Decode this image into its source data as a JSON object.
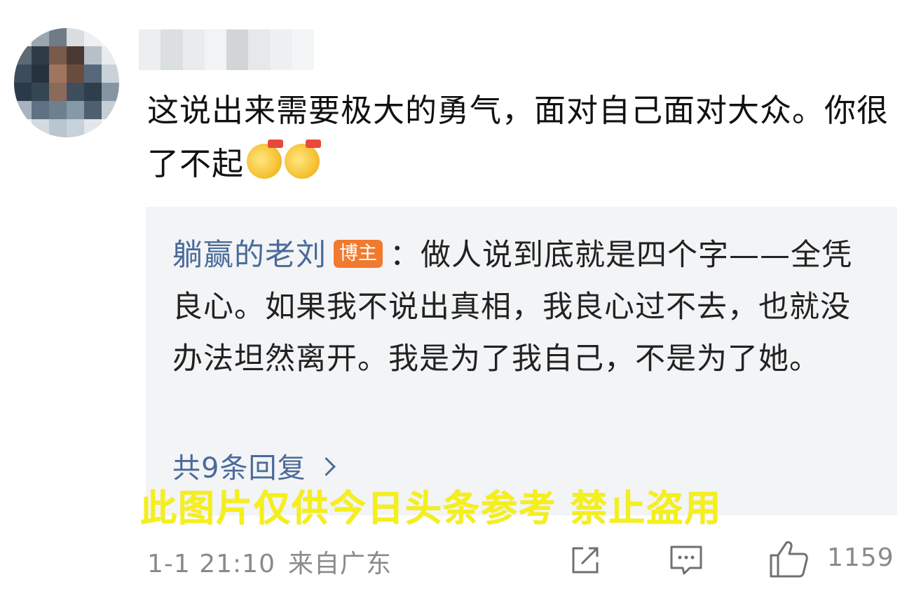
{
  "comment": {
    "text": "这说出来需要极大的勇气，面对自己面对大众。你很了不起",
    "emoji_icons": [
      "666-emoji-icon",
      "666-emoji-icon"
    ]
  },
  "reply": {
    "author": "躺赢的老刘",
    "badge": "博主",
    "separator": "：",
    "text": "做人说到底就是四个字——全凭良心。如果我不说出真相，我良心过不去，也就没办法坦然离开。我是为了我自己，不是为了她。",
    "more_label": "共9条回复"
  },
  "watermark": "此图片仅供今日头条参考 禁止盗用",
  "footer": {
    "date": "1-1 21:10",
    "location": "来自广东",
    "like_count": "1159"
  },
  "icons": {
    "share": "share-icon",
    "comment": "comment-icon",
    "like": "thumbs-up-icon"
  },
  "colors": {
    "link": "#4a6b9a",
    "badge": "#f07a2e",
    "watermark": "#f5ef1a"
  }
}
